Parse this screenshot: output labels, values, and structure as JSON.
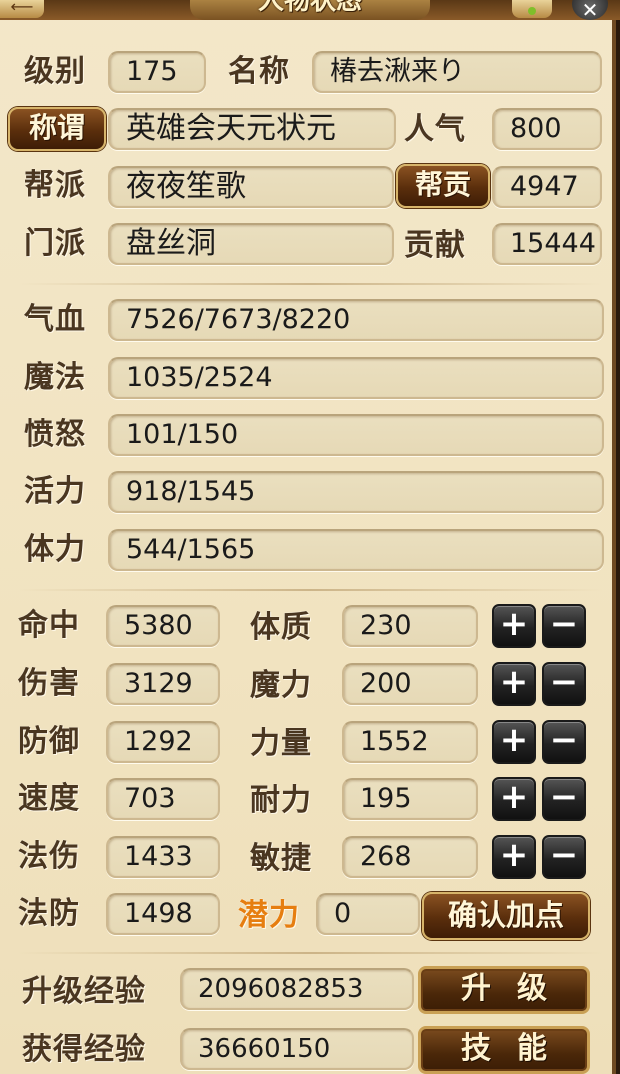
{
  "window": {
    "title": "人物状态",
    "close_glyph": "✕",
    "back_glyph": "⟵"
  },
  "profile": {
    "level_label": "级别",
    "level": "175",
    "name_label": "名称",
    "name": "椿去湫来り",
    "title_button": "称谓",
    "title_value": "英雄会天元状元",
    "popularity_label": "人气",
    "popularity": "800",
    "guild_label": "帮派",
    "guild": "夜夜笙歌",
    "guild_contrib_button": "帮贡",
    "guild_contrib": "4947",
    "sect_label": "门派",
    "sect": "盘丝洞",
    "contribution_label": "贡献",
    "contribution": "15444"
  },
  "vitals": [
    {
      "label": "气血",
      "value": "7526/7673/8220"
    },
    {
      "label": "魔法",
      "value": "1035/2524"
    },
    {
      "label": "愤怒",
      "value": "101/150"
    },
    {
      "label": "活力",
      "value": "918/1545"
    },
    {
      "label": "体力",
      "value": "544/1565"
    }
  ],
  "combat": [
    {
      "label": "命中",
      "value": "5380"
    },
    {
      "label": "伤害",
      "value": "3129"
    },
    {
      "label": "防御",
      "value": "1292"
    },
    {
      "label": "速度",
      "value": "703"
    },
    {
      "label": "法伤",
      "value": "1433"
    },
    {
      "label": "法防",
      "value": "1498"
    }
  ],
  "attributes": [
    {
      "label": "体质",
      "value": "230"
    },
    {
      "label": "魔力",
      "value": "200"
    },
    {
      "label": "力量",
      "value": "1552"
    },
    {
      "label": "耐力",
      "value": "195"
    },
    {
      "label": "敏捷",
      "value": "268"
    }
  ],
  "plus_glyph": "+",
  "minus_glyph": "−",
  "potential_label": "潜力",
  "potential": "0",
  "confirm_button": "确认加点",
  "levelup_exp_label": "升级经验",
  "levelup_exp": "2096082853",
  "levelup_button": "升级",
  "gained_exp_label": "获得经验",
  "gained_exp": "36660150",
  "skills_button": "技能",
  "colors": {
    "panel_bg": "#f1e3c0",
    "label_text": "#4a3620",
    "potential_text": "#e67e10",
    "button_dark": "#4a2709",
    "button_border": "#c9a055"
  }
}
